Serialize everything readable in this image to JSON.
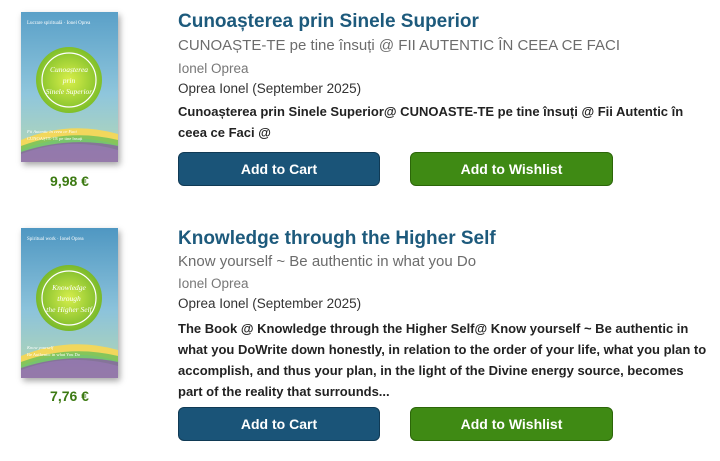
{
  "books": [
    {
      "title": "Cunoașterea prin Sinele Superior",
      "subtitle": "CUNOAȘTE-TE pe tine însuți @ FII AUTENTIC ÎN CEEA CE FACI",
      "author": "Ionel Oprea",
      "publisher": "Oprea Ionel (September 2025)",
      "description": "Cunoașterea prin Sinele Superior@ CUNOASTE-TE pe tine însuți @ Fii Autentic în ceea ce Faci @",
      "price": "9,98 €",
      "add_to_cart_label": "Add to Cart",
      "add_to_wishlist_label": "Add to Wishlist",
      "cover": {
        "header": "Lucrare spirituală · Ionel Oprea",
        "title_lines": [
          "Cunoașterea",
          "prin",
          "Sinele Superior"
        ],
        "bottom_lines": [
          "Fii Autentic în ceea ce Faci",
          "CUNOAȘTE-TE pe tine însuți"
        ]
      }
    },
    {
      "title": "Knowledge through the Higher Self",
      "subtitle": "Know yourself ~ Be authentic in what you Do",
      "author": "Ionel Oprea",
      "publisher": "Oprea Ionel (September 2025)",
      "description": "The Book @ Knowledge through the Higher Self@ Know yourself ~ Be authentic in what you DoWrite down honestly, in relation to the order of your life, what you plan to accomplish, and thus your plan, in the light of the Divine energy source, becomes part of the reality that surrounds...",
      "price": "7,76 €",
      "add_to_cart_label": "Add to Cart",
      "add_to_wishlist_label": "Add to Wishlist",
      "cover": {
        "header": "Spiritual work · Ionel Oprea",
        "title_lines": [
          "Knowledge",
          "through",
          "the Higher Self"
        ],
        "bottom_lines": [
          "Know yourself",
          "Be Authentic in what You Do"
        ]
      }
    }
  ],
  "colors": {
    "title": "#1d5a7c",
    "price": "#3c7a12",
    "cart_button": "#1a5478",
    "wishlist_button": "#3f8a14"
  }
}
